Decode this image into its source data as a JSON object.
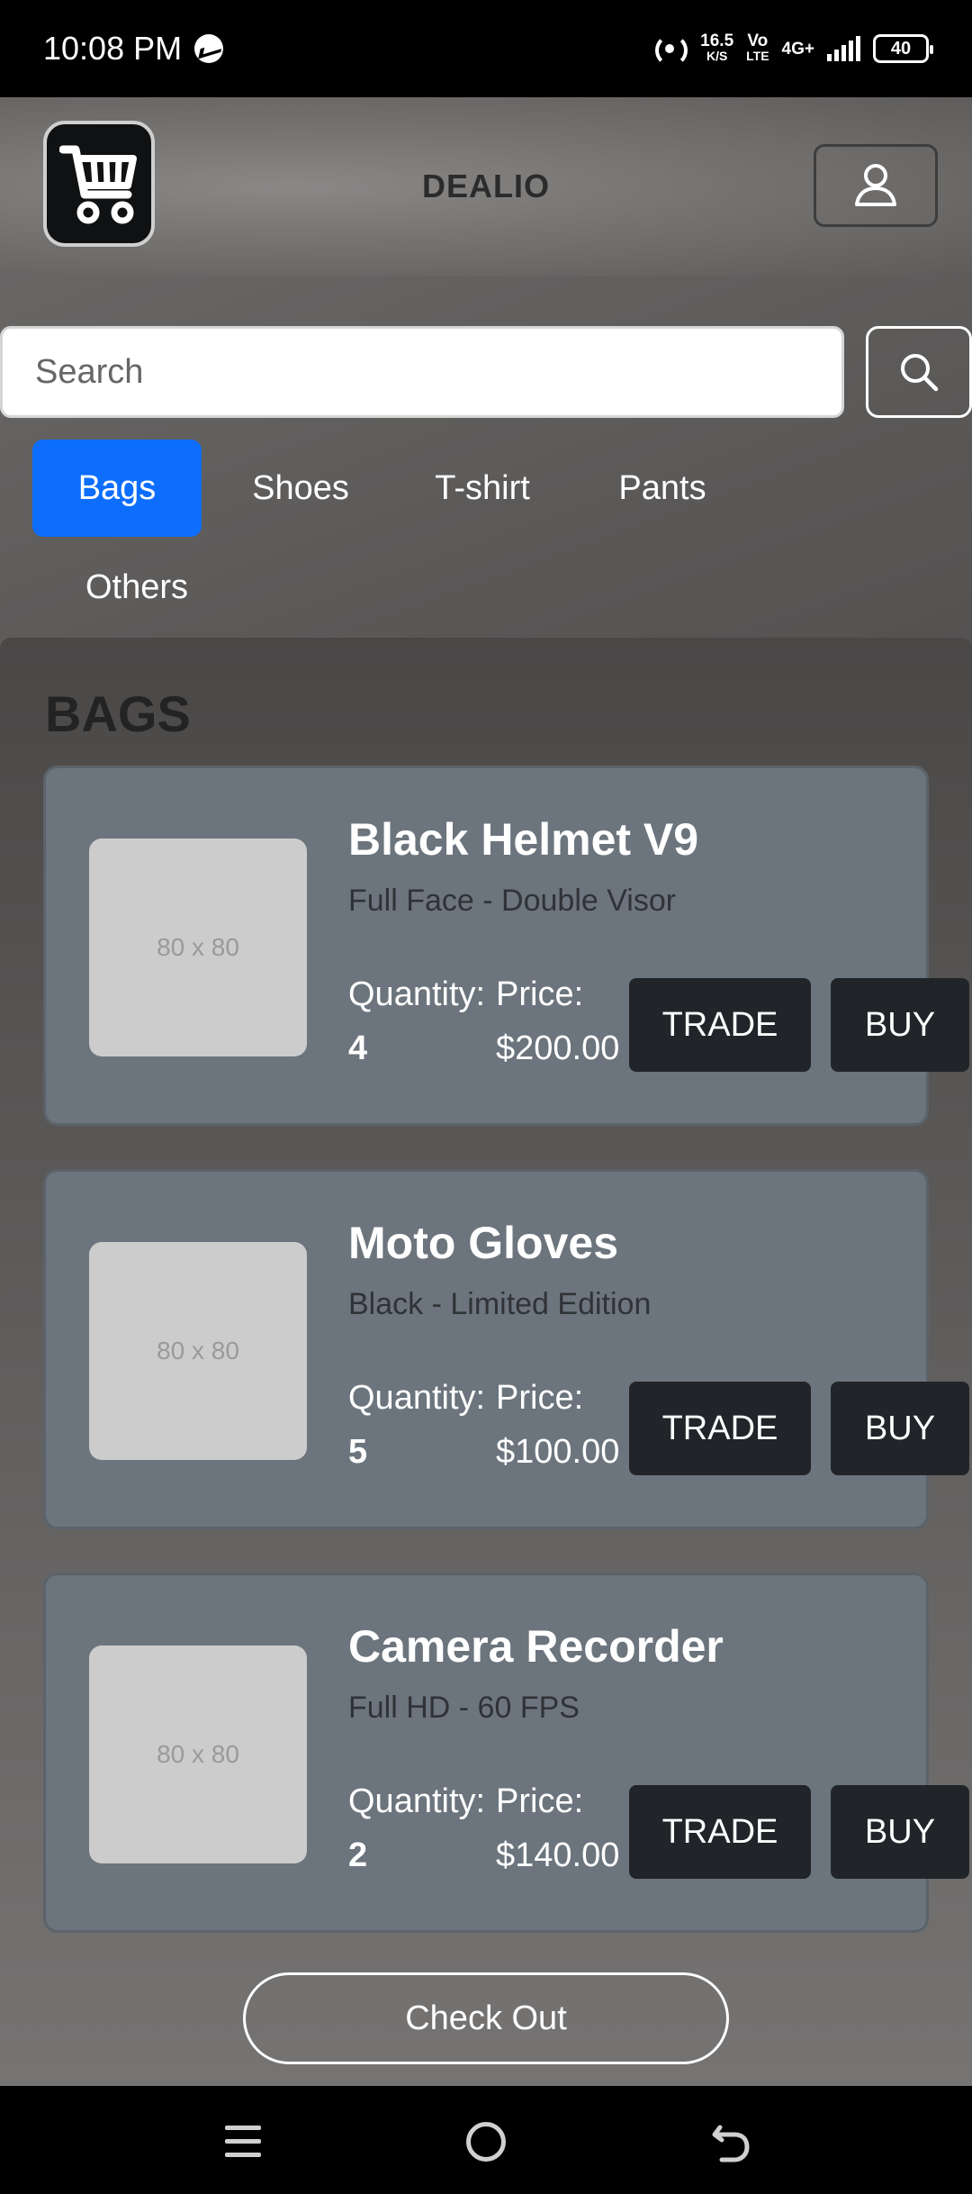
{
  "status_bar": {
    "time": "10:08 PM",
    "net_speed": "16.5",
    "net_unit": "K/S",
    "volte_top": "Vo",
    "volte_bottom": "LTE",
    "network": "4G+",
    "battery": "40"
  },
  "header": {
    "brand": "DEALIO",
    "logo_icon": "shopping-cart-icon",
    "profile_icon": "user-icon"
  },
  "search": {
    "placeholder": "Search",
    "value": "",
    "button_icon": "search-icon"
  },
  "categories": [
    {
      "label": "Bags",
      "active": true
    },
    {
      "label": "Shoes",
      "active": false
    },
    {
      "label": "T-shirt",
      "active": false
    },
    {
      "label": "Pants",
      "active": false
    },
    {
      "label": "Others",
      "active": false
    }
  ],
  "section": {
    "title": "BAGS"
  },
  "products": [
    {
      "image_placeholder": "80 x 80",
      "name": "Black Helmet V9",
      "description": "Full Face - Double Visor",
      "quantity_label": "Quantity:",
      "quantity": "4",
      "price_label": "Price:",
      "price": "$200.00",
      "trade_label": "TRADE",
      "buy_label": "BUY"
    },
    {
      "image_placeholder": "80 x 80",
      "name": "Moto Gloves",
      "description": "Black - Limited Edition",
      "quantity_label": "Quantity:",
      "quantity": "5",
      "price_label": "Price:",
      "price": "$100.00",
      "trade_label": "TRADE",
      "buy_label": "BUY"
    },
    {
      "image_placeholder": "80 x 80",
      "name": "Camera Recorder",
      "description": "Full HD - 60 FPS",
      "quantity_label": "Quantity:",
      "quantity": "2",
      "price_label": "Price:",
      "price": "$140.00",
      "trade_label": "TRADE",
      "buy_label": "BUY"
    }
  ],
  "checkout": {
    "label": "Check Out"
  },
  "colors": {
    "accent": "#0d6efd",
    "card": "#6c757d",
    "button_dark": "#212529"
  }
}
